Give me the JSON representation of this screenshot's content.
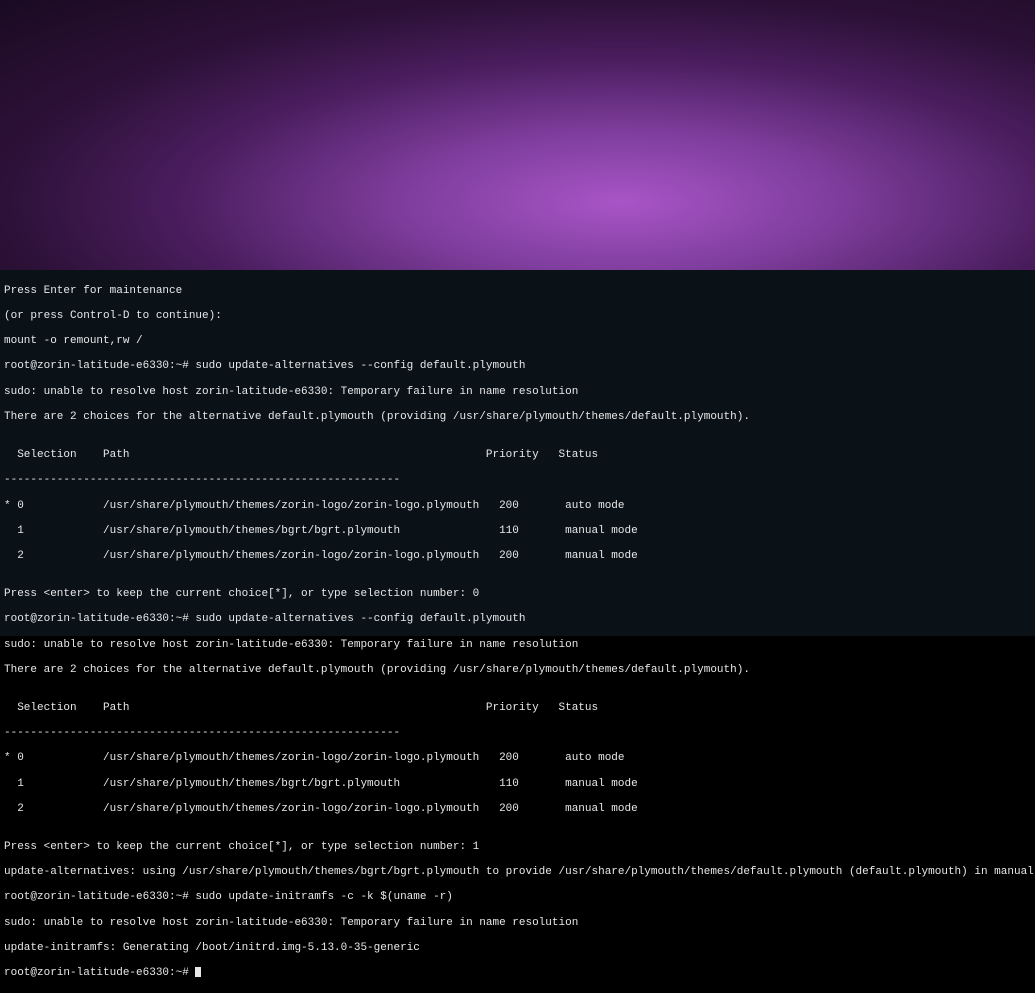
{
  "terminal": {
    "lines": [
      "Press Enter for maintenance",
      "(or press Control-D to continue):",
      "mount -o remount,rw /",
      "root@zorin-latitude-e6330:~# sudo update-alternatives --config default.plymouth",
      "sudo: unable to resolve host zorin-latitude-e6330: Temporary failure in name resolution",
      "There are 2 choices for the alternative default.plymouth (providing /usr/share/plymouth/themes/default.plymouth).",
      "",
      "  Selection    Path                                                      Priority   Status",
      "------------------------------------------------------------",
      "* 0            /usr/share/plymouth/themes/zorin-logo/zorin-logo.plymouth   200       auto mode",
      "  1            /usr/share/plymouth/themes/bgrt/bgrt.plymouth               110       manual mode",
      "  2            /usr/share/plymouth/themes/zorin-logo/zorin-logo.plymouth   200       manual mode",
      "",
      "Press <enter> to keep the current choice[*], or type selection number: 0",
      "root@zorin-latitude-e6330:~# sudo update-alternatives --config default.plymouth",
      "sudo: unable to resolve host zorin-latitude-e6330: Temporary failure in name resolution",
      "There are 2 choices for the alternative default.plymouth (providing /usr/share/plymouth/themes/default.plymouth).",
      "",
      "  Selection    Path                                                      Priority   Status",
      "------------------------------------------------------------",
      "* 0            /usr/share/plymouth/themes/zorin-logo/zorin-logo.plymouth   200       auto mode",
      "  1            /usr/share/plymouth/themes/bgrt/bgrt.plymouth               110       manual mode",
      "  2            /usr/share/plymouth/themes/zorin-logo/zorin-logo.plymouth   200       manual mode",
      "",
      "Press <enter> to keep the current choice[*], or type selection number: 1",
      "update-alternatives: using /usr/share/plymouth/themes/bgrt/bgrt.plymouth to provide /usr/share/plymouth/themes/default.plymouth (default.plymouth) in manual mode",
      "root@zorin-latitude-e6330:~# sudo update-initramfs -c -k $(uname -r)",
      "sudo: unable to resolve host zorin-latitude-e6330: Temporary failure in name resolution",
      "update-initramfs: Generating /boot/initrd.img-5.13.0-35-generic",
      "root@zorin-latitude-e6330:~# "
    ]
  }
}
